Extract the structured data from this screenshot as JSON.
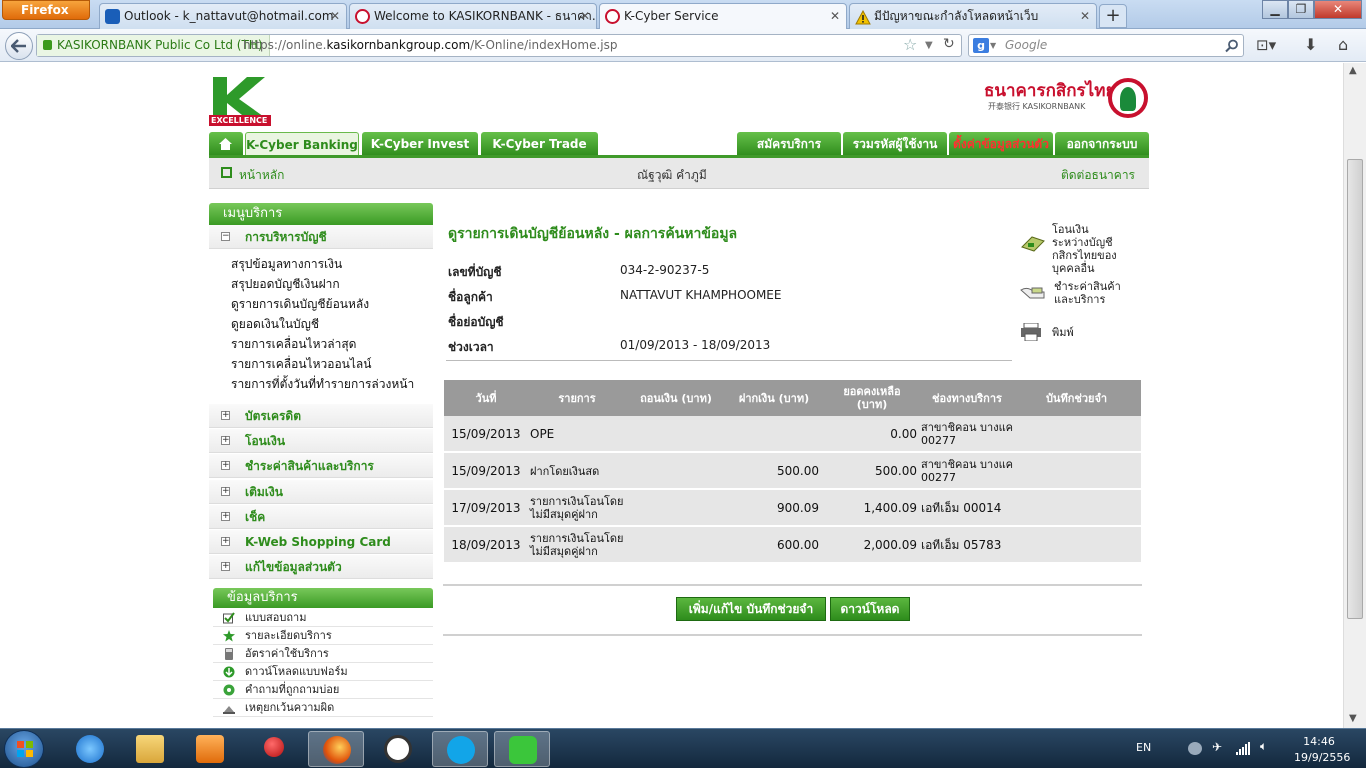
{
  "browser": {
    "menu_button": "Firefox",
    "tabs": [
      {
        "title": "Outlook - k_nattavut@hotmail.com",
        "icon": "outlook-icon",
        "color": "#1a5eb8"
      },
      {
        "title": "Welcome to KASIKORNBANK - ธนาคา...",
        "icon": "kbank-icon",
        "color": "#c8102e"
      },
      {
        "title": "K-Cyber Service",
        "icon": "kbank-icon",
        "color": "#c8102e"
      },
      {
        "title": "มีปัญหาขณะกำลังโหลดหน้าเว็บ",
        "icon": "warning-icon",
        "color": "#e8b000"
      }
    ],
    "new_tab": "+",
    "site_identity": "KASIKORNBANK Public Co Ltd (TH)",
    "url_prefix": "https://online.",
    "url_domain": "kasikornbankgroup.com",
    "url_path": "/K-Online/indexHome.jsp",
    "search_placeholder": "Google"
  },
  "header": {
    "logo_text": "EXCELLENCE",
    "bank_name_th": "ธนาคารกสิกรไทย",
    "bank_name_en": "开泰银行 KASIKORNBANK"
  },
  "nav": {
    "tabs_left": [
      "K-Cyber Banking",
      "K-Cyber Invest",
      "K-Cyber Trade"
    ],
    "tabs_right": [
      "สมัครบริการ",
      "รวมรหัสผู้ใช้งาน",
      "ตั้งค่าข้อมูลส่วนตัว",
      "ออกจากระบบ"
    ],
    "home_link": "หน้าหลัก",
    "user_name": "ณัฐวุฒิ คำภูมี",
    "contact_link": "ติดต่อธนาคาร"
  },
  "left_menu": {
    "title": "เมนูบริการ",
    "account_section": "การบริหารบัญชี",
    "account_items": [
      "สรุปข้อมูลทางการเงิน",
      "สรุปยอดบัญชีเงินฝาก",
      "ดูรายการเดินบัญชีย้อนหลัง",
      "ดูยอดเงินในบัญชี",
      "รายการเคลื่อนไหวล่าสุด",
      "รายการเคลื่อนไหวออนไลน์",
      "รายการที่ตั้งวันที่ทำรายการล่วงหน้า"
    ],
    "sections": [
      "บัตรเครดิต",
      "โอนเงิน",
      "ชำระค่าสินค้าและบริการ",
      "เติมเงิน",
      "เช็ค",
      "K-Web Shopping Card",
      "แก้ไขข้อมูลส่วนตัว"
    ],
    "info_title": "ข้อมูลบริการ",
    "info_items": [
      "แบบสอบถาม",
      "รายละเอียดบริการ",
      "อัตราค่าใช้บริการ",
      "ดาวน์โหลดแบบฟอร์ม",
      "คำถามที่ถูกถามบ่อย",
      "เหตุยกเว้นความผิด"
    ]
  },
  "main": {
    "title": "ดูรายการเดินบัญชีย้อนหลัง - ผลการค้นหาข้อมูล",
    "fields": [
      {
        "label": "เลขที่บัญชี",
        "value": "034-2-90237-5"
      },
      {
        "label": "ชื่อลูกค้า",
        "value": "NATTAVUT KHAMPHOOMEE"
      },
      {
        "label": "ชื่อย่อบัญชี",
        "value": ""
      },
      {
        "label": "ช่วงเวลา",
        "value": "01/09/2013 - 18/09/2013"
      }
    ],
    "actions": [
      {
        "text": "โอนเงินระหว่างบัญชีกสิกรไทยของบุคคลอื่น",
        "icon": "transfer-icon"
      },
      {
        "text": "ชำระค่าสินค้าและบริการ",
        "icon": "payment-icon"
      },
      {
        "text": "พิมพ์",
        "icon": "printer-icon"
      }
    ],
    "table_headers": [
      "วันที่",
      "รายการ",
      "ถอนเงิน (บาท)",
      "ฝากเงิน (บาท)",
      "ยอดคงเหลือ (บาท)",
      "ช่องทางบริการ",
      "บันทึกช่วยจำ"
    ],
    "rows": [
      [
        "15/09/2013",
        "OPE",
        "",
        "",
        "0.00",
        "สาขาชิคอน บางแค 00277",
        ""
      ],
      [
        "15/09/2013",
        "ฝากโดยเงินสด",
        "",
        "500.00",
        "500.00",
        "สาขาชิคอน บางแค 00277",
        ""
      ],
      [
        "17/09/2013",
        "รายการเงินโอนโดยไม่มีสมุดคู่ฝาก",
        "",
        "900.09",
        "1,400.09",
        "เอทีเอ็ม 00014",
        ""
      ],
      [
        "18/09/2013",
        "รายการเงินโอนโดยไม่มีสมุดคู่ฝาก",
        "",
        "600.00",
        "2,000.09",
        "เอทีเอ็ม 05783",
        ""
      ]
    ],
    "buttons": [
      "เพิ่ม/แก้ไข บันทึกช่วยจำ",
      "ดาวน์โหลด"
    ]
  },
  "taskbar": {
    "apps": [
      "ie-icon",
      "explorer-icon",
      "media-icon",
      "pin-icon",
      "firefox-icon",
      "clock-icon",
      "skype-icon",
      "line-icon"
    ],
    "lang": "EN",
    "time": "14:46",
    "date": "19/9/2556"
  },
  "colors": {
    "accent": "#2e8c1c",
    "brand_red": "#c8102e"
  }
}
